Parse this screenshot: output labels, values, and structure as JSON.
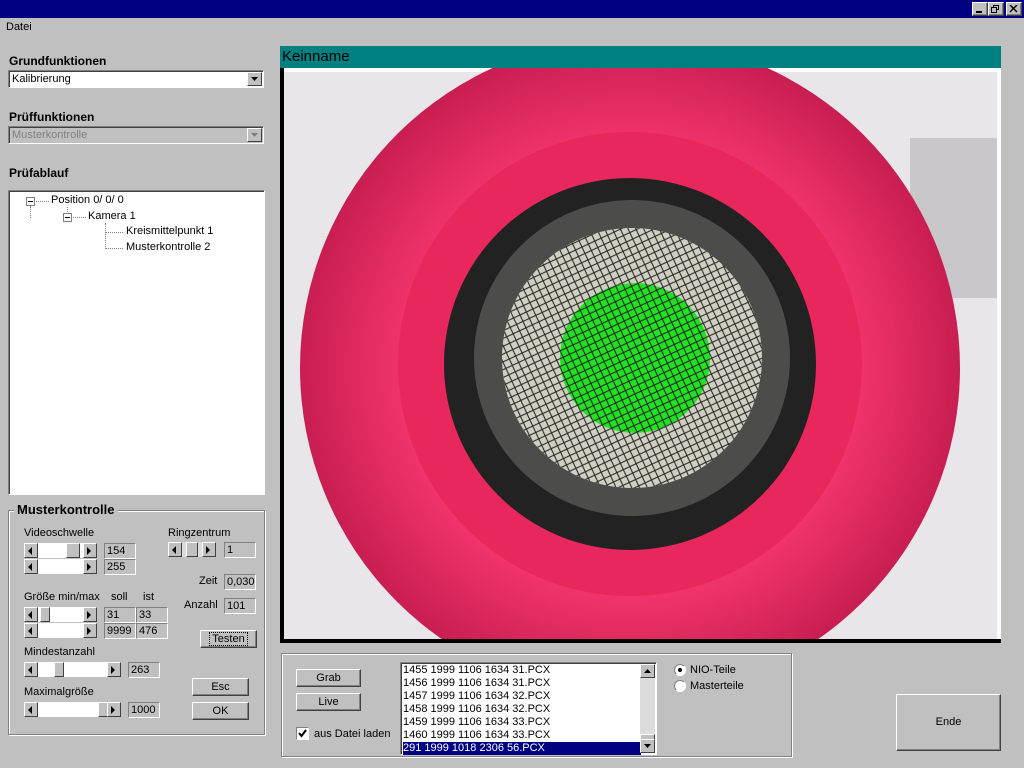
{
  "menu": {
    "file": "Datei"
  },
  "left": {
    "grundfunktionen_label": "Grundfunktionen",
    "grundfunktionen_value": "Kalibrierung",
    "pruef_label": "Prüffunktionen",
    "pruef_value": "Musterkontrolle",
    "ablauf_label": "Prüfablauf",
    "tree": {
      "position": "Position  0/ 0/ 0",
      "kamera": "Kamera  1",
      "kreis": "Kreismittelpunkt 1",
      "muster": "Musterkontrolle 2"
    }
  },
  "muster": {
    "title": "Musterkontrolle",
    "videoschwelle_label": "Videoschwelle",
    "video_val1": "154",
    "video_val2": "255",
    "ringzentrum_label": "Ringzentrum",
    "ring_val": "1",
    "zeit_label": "Zeit",
    "zeit_val": "0,030",
    "anzahl_label": "Anzahl",
    "anzahl_val": "101",
    "groesse_label": "Größe min/max",
    "soll_label": "soll",
    "ist_label": "ist",
    "min_soll": "31",
    "min_ist": "33",
    "max_soll": "9999",
    "max_ist": "476",
    "testen_label": "Testen",
    "mindest_label": "Mindestanzahl",
    "mindest_val": "263",
    "maximal_label": "Maximalgröße",
    "maximal_val": "1000",
    "esc_label": "Esc",
    "ok_label": "OK"
  },
  "video": {
    "title": "Keinname"
  },
  "bottom": {
    "grab_label": "Grab",
    "live_label": "Live",
    "aus_datei_label": "aus Datei laden",
    "aus_datei_checked": true,
    "files": [
      "1455 1999 1106 1634 31.PCX",
      "1456 1999 1106 1634 31.PCX",
      "1457 1999 1106 1634 32.PCX",
      "1458 1999 1106 1634 32.PCX",
      "1459 1999 1106 1634 33.PCX",
      "1460 1999 1106 1634 33.PCX",
      "291 1999 1018 2306 56.PCX"
    ],
    "selected_file": "291 1999 1018 2306 56.PCX",
    "radio_nio": "NIO-Teile",
    "radio_master": "Masterteile",
    "radio_selected": "NIO-Teile",
    "ende_label": "Ende"
  }
}
